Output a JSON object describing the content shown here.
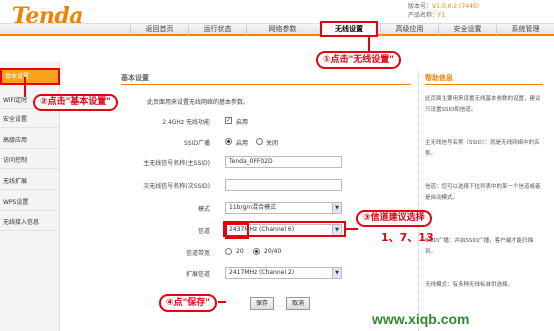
{
  "header": {
    "logo": "Tenda",
    "version_label": "版本号",
    "version_value": "V1.0.0.2 (7445)",
    "product_label": "产品名称",
    "product_value": "F1"
  },
  "nav": {
    "tabs": [
      "返回首页",
      "运行状态",
      "网络参数",
      "无线设置",
      "高级应用",
      "安全设置",
      "系统管理"
    ],
    "active_index": 3
  },
  "sidebar": {
    "items": [
      "基本设置",
      "WiFi定时",
      "安全设置",
      "高级应用",
      "访问控制",
      "无线扩展",
      "WPS设置",
      "无线接入信息"
    ],
    "active_index": 0
  },
  "main": {
    "title": "基本设置",
    "description": "此页面用来设置无线网络的基本参数。",
    "wifi_enable_label": "2.4GHz 无线功能",
    "wifi_enable_value": "启用",
    "ssid_broadcast_label": "SSID广播",
    "ssid_broadcast_on": "启用",
    "ssid_broadcast_off": "关闭",
    "ssid_label": "主无线信号名称(主SSID)",
    "ssid_value": "Tenda_0FF02D",
    "ssid2_label": "次无线信号名称(次SSID)",
    "ssid2_value": "",
    "mode_label": "模式",
    "mode_value": "11b/g/n混合模式",
    "channel_label": "信道",
    "channel_value": "2437MHz (Channel 6)",
    "bandwidth_label": "信道带宽",
    "bandwidth_20": "20",
    "bandwidth_2040": "20/40",
    "ext_channel_label": "扩展信道",
    "ext_channel_value": "2417MHz (Channel 2)",
    "save_button": "保存",
    "cancel_button": "取消"
  },
  "help": {
    "title": "帮助信息",
    "paragraphs": [
      "此页面主要用来设置无线基本参数的设置，建议只设置SSID和信道。",
      "主无线信号名称（SSID）：就是无线网络中的名称。",
      "信道：您可以选择下拉列表中的某一个信道或者是自动模式。",
      "SSID广播：并启SSID广播，客户端才能扫描到。",
      "无线模式：有多种无线标准供选择。"
    ]
  },
  "annotations": {
    "step1": "①点击\"无线设置\"",
    "step2": "②点击\"基本设置\"",
    "step3": "③信道建议选择",
    "step3_channels": "1、7、13",
    "step4": "④点\"保存\""
  },
  "watermark": "www.xiqb.com",
  "colors": {
    "brand": "#f08300",
    "annotation": "#e60012",
    "watermark": "#2f8b2f"
  }
}
